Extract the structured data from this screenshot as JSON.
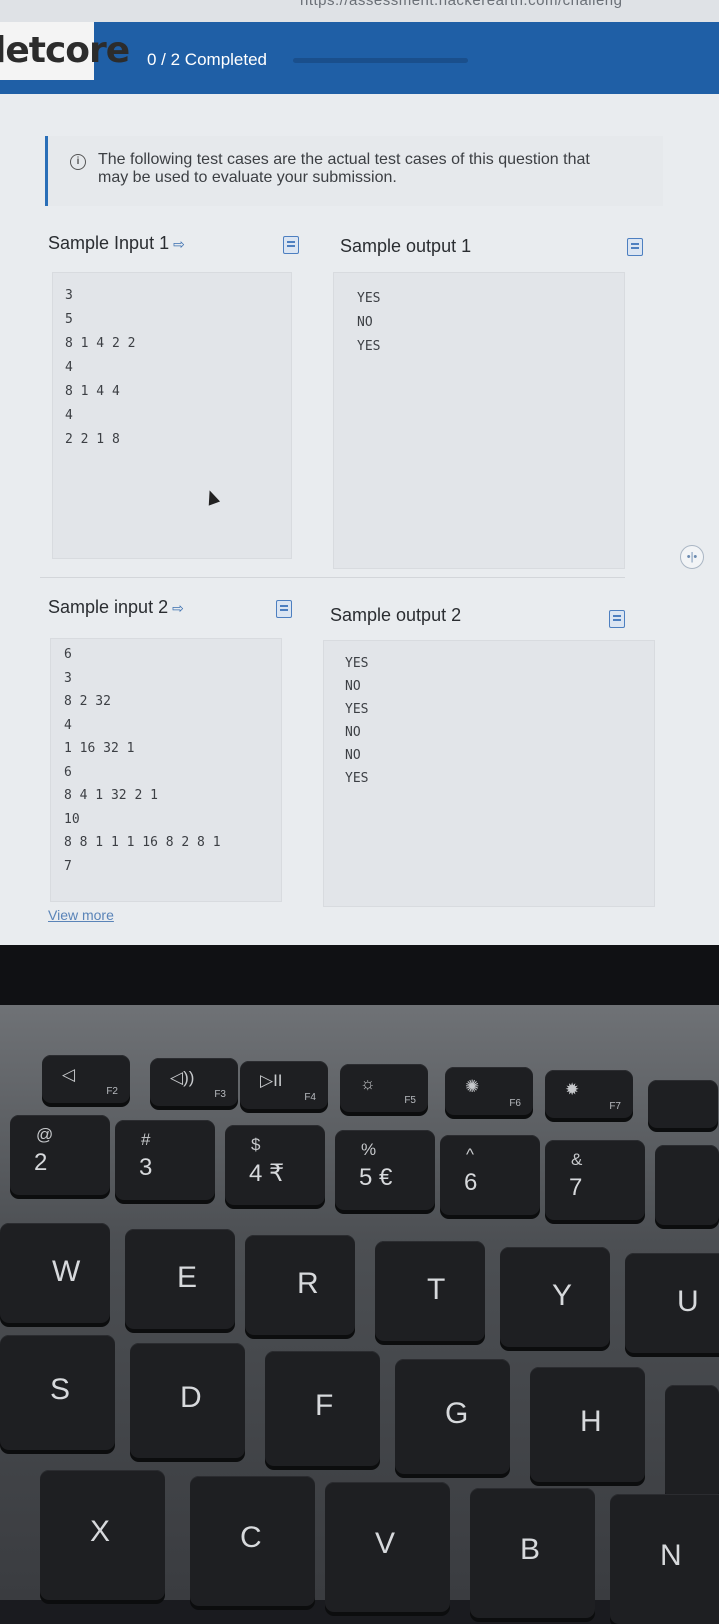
{
  "browser": {
    "url_fragment": "https://assessment.hackerearth.com/challeng"
  },
  "header": {
    "logo_text": "letcore",
    "progress_label": "0 / 2 Completed",
    "progress_fraction": 0.0
  },
  "info": {
    "message": "The following test cases are the actual test cases of this question that may be used to evaluate your submission."
  },
  "samples": [
    {
      "input_title": "Sample Input 1",
      "output_title": "Sample output 1",
      "input_lines": [
        "3",
        "5",
        "8 1 4 2 2",
        "4",
        "8 1 4 4",
        "4",
        "2 2 1 8"
      ],
      "output_lines": [
        "YES",
        "NO",
        "YES"
      ]
    },
    {
      "input_title": "Sample input 2",
      "output_title": "Sample output 2",
      "input_lines": [
        "6",
        "3",
        "8 2 32",
        "4",
        "1 16 32 1",
        "6",
        "8 4 1 32 2 1",
        "10",
        "8 8 1 1 1 16 8 2 8 1",
        "7"
      ],
      "output_lines": [
        "YES",
        "NO",
        "YES",
        "NO",
        "NO",
        "YES"
      ],
      "view_more": "View more"
    }
  ],
  "keyboard": {
    "fn_row": [
      {
        "glyph": "◁",
        "fn": "F2"
      },
      {
        "glyph": "◁))",
        "fn": "F3"
      },
      {
        "glyph": "▷II",
        "fn": "F4"
      },
      {
        "glyph": "☼",
        "fn": "F5"
      },
      {
        "glyph": "✺",
        "fn": "F6"
      },
      {
        "glyph": "✹",
        "fn": "F7"
      }
    ],
    "number_row": [
      {
        "top": "@",
        "main": "2"
      },
      {
        "top": "#",
        "main": "3"
      },
      {
        "top": "$",
        "main": "4 ₹"
      },
      {
        "top": "%",
        "main": "5 €"
      },
      {
        "top": "^",
        "main": "6"
      },
      {
        "top": "&",
        "main": "7"
      }
    ],
    "qwerty_row": [
      "W",
      "E",
      "R",
      "T",
      "Y",
      "U"
    ],
    "home_row": [
      "S",
      "D",
      "F",
      "G",
      "H"
    ],
    "bottom_row": [
      "X",
      "C",
      "V",
      "B",
      "N"
    ]
  }
}
